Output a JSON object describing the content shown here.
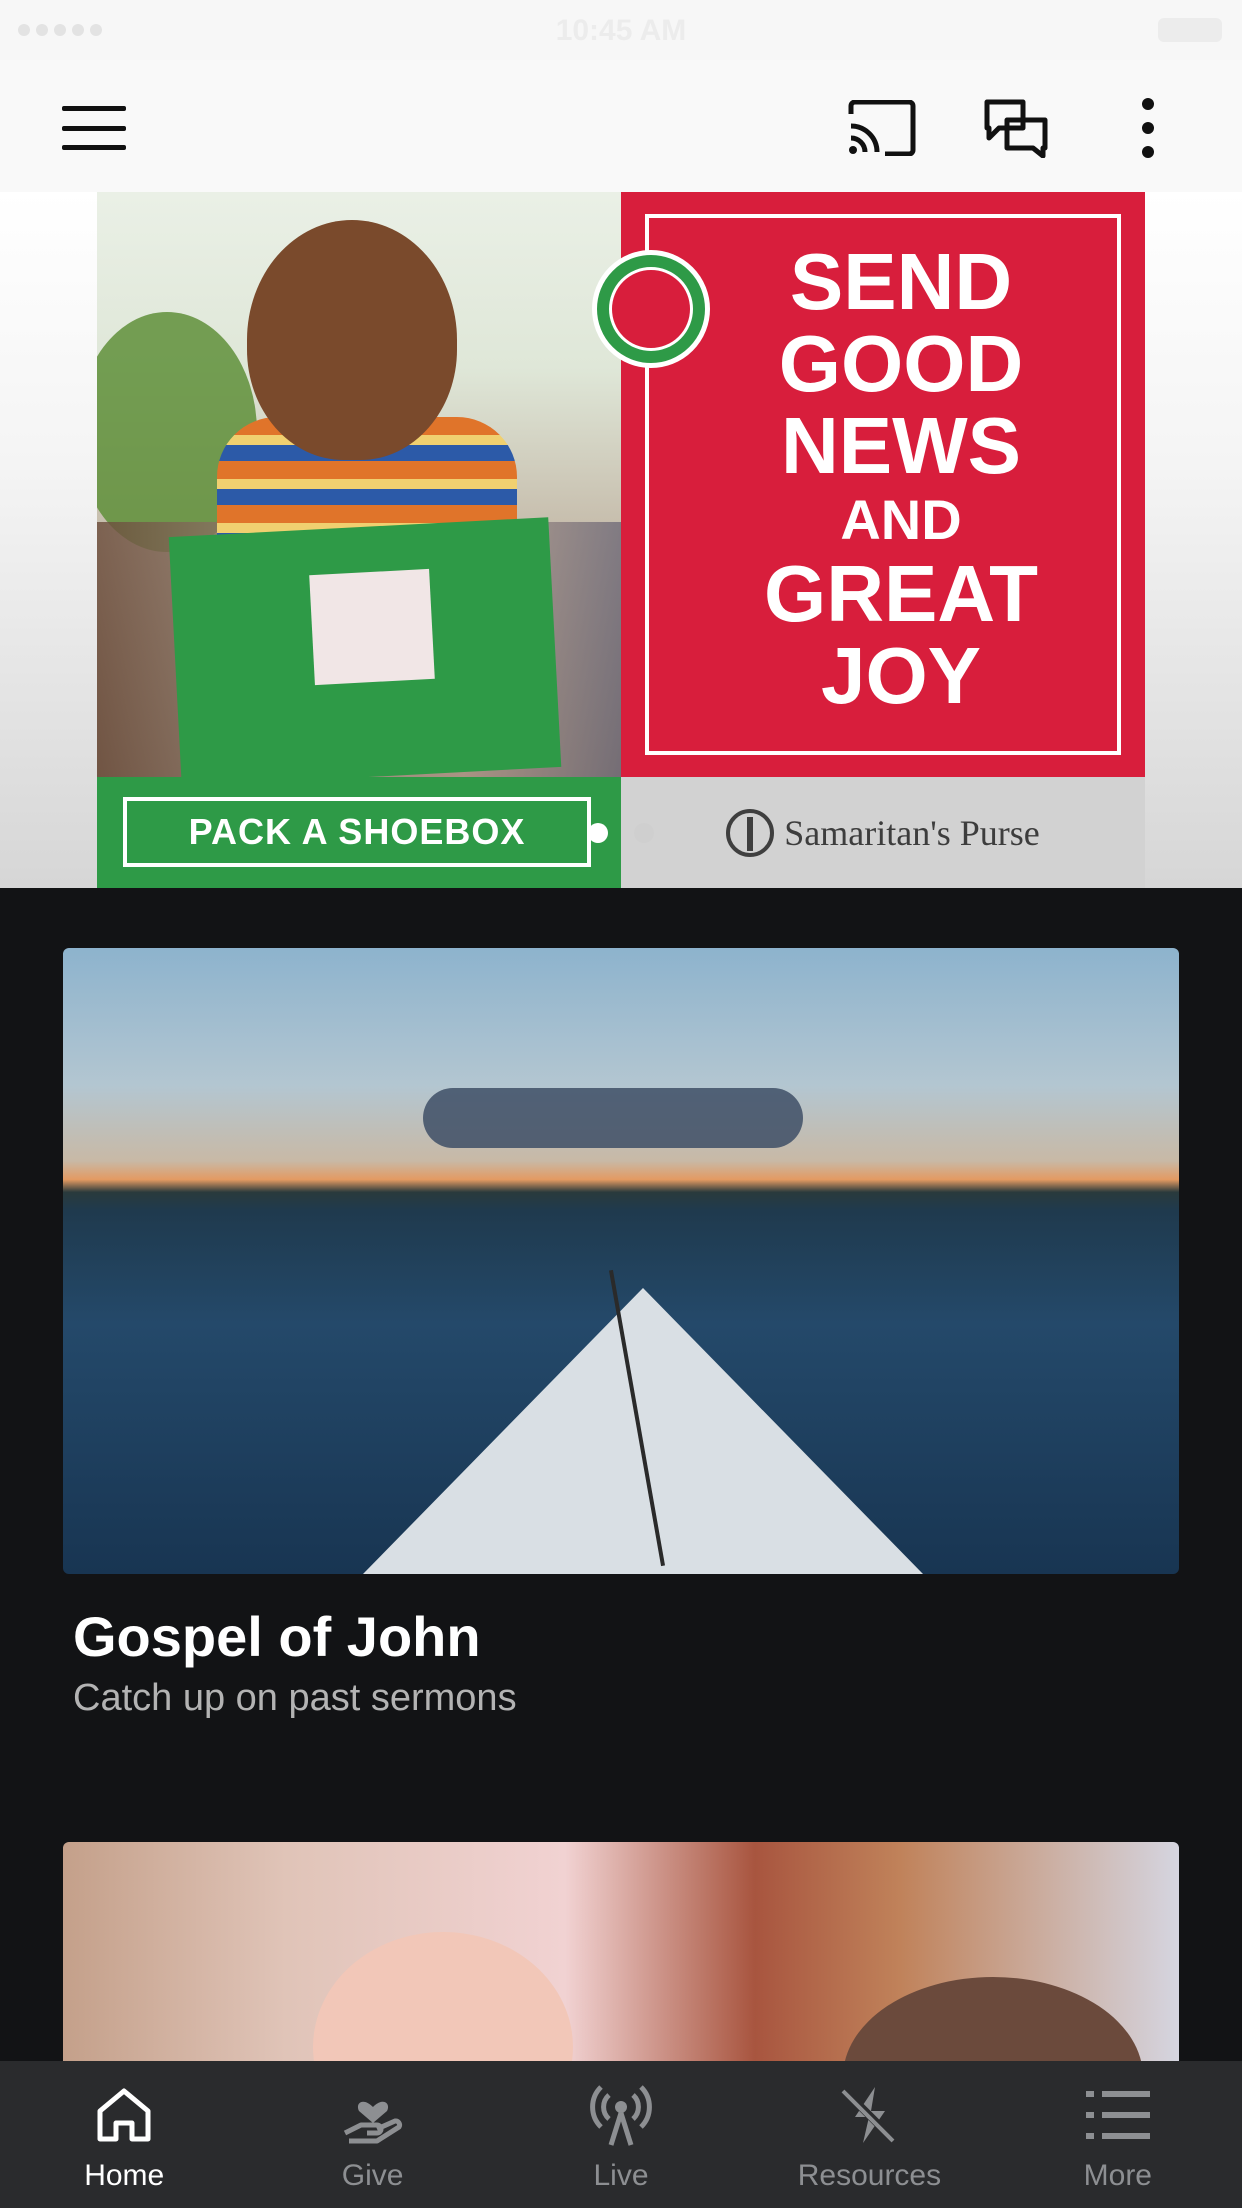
{
  "status_bar": {
    "time": "10:45 AM"
  },
  "header": {
    "menu_icon": "hamburger-menu-icon",
    "actions": [
      "cast-icon",
      "chat-icon",
      "kebab-menu-icon"
    ]
  },
  "hero": {
    "headline_lines": [
      "SEND",
      "GOOD",
      "NEWS",
      "AND",
      "GREAT",
      "JOY"
    ],
    "cta": "PACK A SHOEBOX",
    "brand": "Samaritan's Purse",
    "slides": 2,
    "active_slide": 1
  },
  "cards": [
    {
      "title": "Gospel of John",
      "subtitle": "Catch up on past sermons"
    },
    {
      "title": "",
      "subtitle": ""
    }
  ],
  "tabs": [
    {
      "label": "Home",
      "icon": "home-icon",
      "active": true
    },
    {
      "label": "Give",
      "icon": "give-icon",
      "active": false
    },
    {
      "label": "Live",
      "icon": "live-broadcast-icon",
      "active": false
    },
    {
      "label": "Resources",
      "icon": "resources-icon",
      "active": false
    },
    {
      "label": "More",
      "icon": "list-icon",
      "active": false
    }
  ],
  "colors": {
    "background": "#121315",
    "tab_bar": "#2a2b2d",
    "tab_inactive": "#8d8f92",
    "hero_red": "#d81e3c",
    "hero_green": "#2e9a47"
  }
}
